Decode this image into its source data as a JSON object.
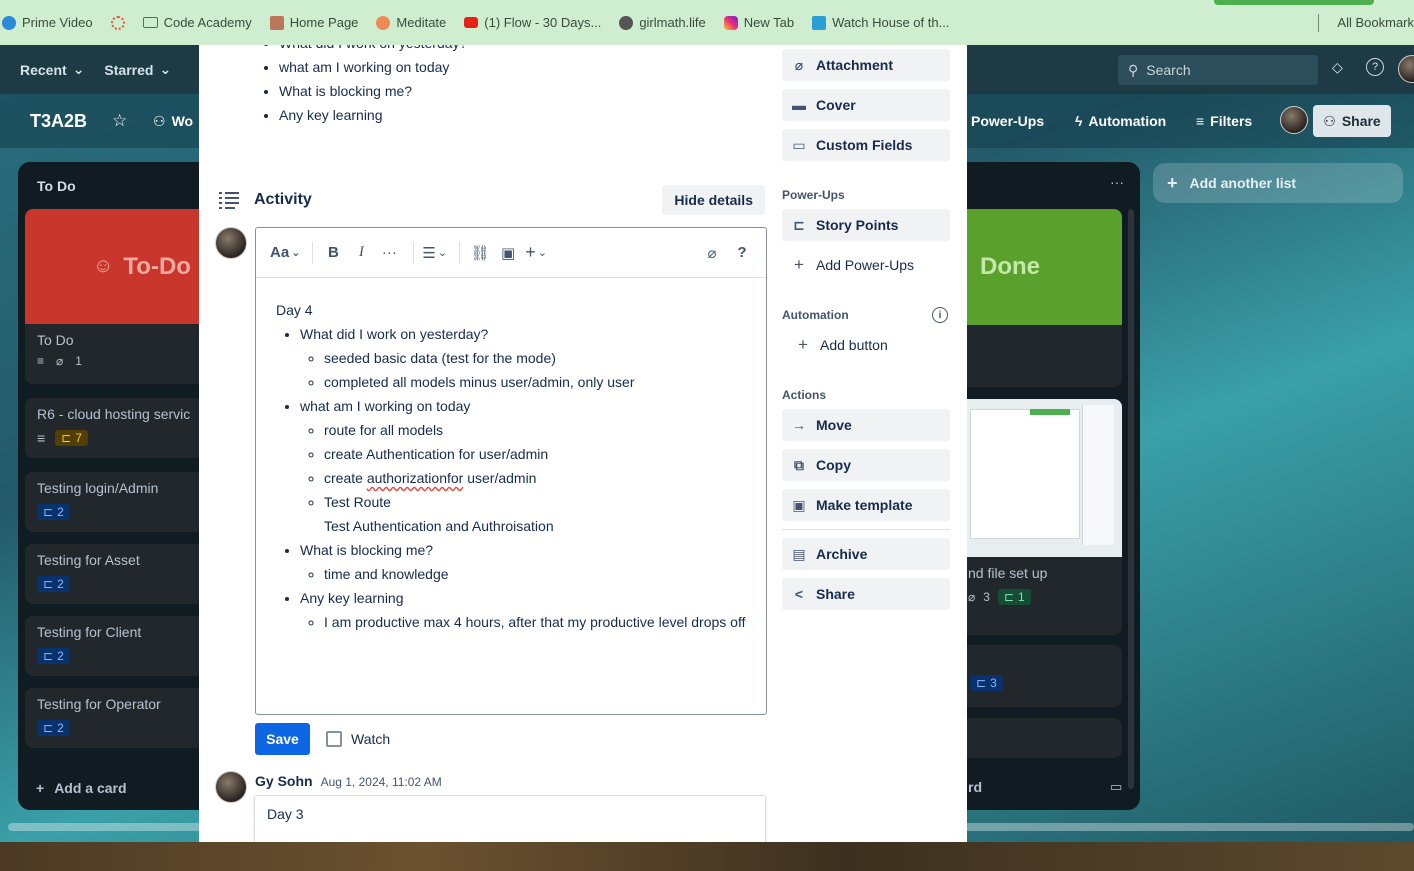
{
  "bookmarks": {
    "items": [
      {
        "label": "Prime Video",
        "icon": "prime-video-icon",
        "color": "#2a8bd6"
      },
      {
        "label": "",
        "icon": "spinner-icon",
        "color": "#e25a3a"
      },
      {
        "label": "Code Academy",
        "icon": "folder-icon",
        "color": ""
      },
      {
        "label": "Home Page",
        "icon": "person-icon",
        "color": "#b9785a"
      },
      {
        "label": "Meditate",
        "icon": "meditate-icon",
        "color": "#ee8a55"
      },
      {
        "label": "(1) Flow - 30 Days...",
        "icon": "youtube-icon",
        "color": "#e62117"
      },
      {
        "label": "girlmath.life",
        "icon": "globe-icon",
        "color": "#555555"
      },
      {
        "label": "New Tab",
        "icon": "instagram-icon",
        "color": "#d6249f"
      },
      {
        "label": "Watch House of th...",
        "icon": "play-icon",
        "color": "#2a9fd6"
      }
    ],
    "all_bookmarks": "All Bookmark"
  },
  "topnav": {
    "recent": "Recent",
    "starred": "Starred",
    "search_placeholder": "Search"
  },
  "board": {
    "title": "T3A2B",
    "workspace_partial": "Wo",
    "power_ups": "Power-Ups",
    "automation": "Automation",
    "filters": "Filters",
    "share": "Share",
    "add_another_list": "Add another list"
  },
  "list_left": {
    "title": "To Do",
    "cover_text": "To-Do",
    "cards": [
      {
        "title": "To Do",
        "badge": "1"
      },
      {
        "title": "R6 - cloud hosting servic",
        "badge": "7"
      },
      {
        "title": "Testing login/Admin",
        "badge": "2"
      },
      {
        "title": "Testing for Asset",
        "badge": "2"
      },
      {
        "title": "Testing for Client",
        "badge": "2"
      },
      {
        "title": "Testing for Operator",
        "badge": "2"
      }
    ],
    "add_card": "Add a card"
  },
  "list_right": {
    "cover_text": "Done",
    "card_title": "nd file set up",
    "attach_count": "3",
    "points": "1",
    "points2": "3",
    "add_card_partial": "rd"
  },
  "modal": {
    "top_bullets": [
      "What did I work on yesterday?",
      "what am I working on today",
      "What is blocking me?",
      "Any key learning"
    ],
    "activity_title": "Activity",
    "hide_details": "Hide details",
    "editor": {
      "toolbar": {
        "text_style": "Aa",
        "bold": "B",
        "italic": "I",
        "more": "···",
        "help": "?"
      },
      "heading": "Day 4",
      "q1": "What did I work on yesterday?",
      "q1_items": [
        "seeded basic data (test for the mode)",
        "completed all models minus user/admin, only user"
      ],
      "q2": "what am I working on today",
      "q2_items": [
        "route for all models",
        "create Authentication for user/admin"
      ],
      "q2_item3_pre": "create ",
      "q2_item3_spell": "authorizationfor",
      "q2_item3_post": " user/admin",
      "q2_item4": "Test Route",
      "q2_item5": "Test Authentication and Authroisation",
      "q3": "What is blocking me?",
      "q3_items": [
        "time and knowledge"
      ],
      "q4": "Any key learning",
      "q4_items": [
        "I am productive max 4 hours, after that my productive level drops off"
      ]
    },
    "save": "Save",
    "watch": "Watch",
    "comment": {
      "author": "Gy Sohn",
      "date": "Aug 1, 2024, 11:02 AM",
      "text": "Day 3"
    }
  },
  "sidebar": {
    "add_to_card": [
      "Attachment",
      "Cover",
      "Custom Fields"
    ],
    "power_ups_label": "Power-Ups",
    "story_points": "Story Points",
    "add_power_ups": "Add Power-Ups",
    "automation_label": "Automation",
    "add_button": "Add button",
    "actions_label": "Actions",
    "actions": [
      "Move",
      "Copy",
      "Make template"
    ],
    "archive": "Archive",
    "share": "Share"
  }
}
